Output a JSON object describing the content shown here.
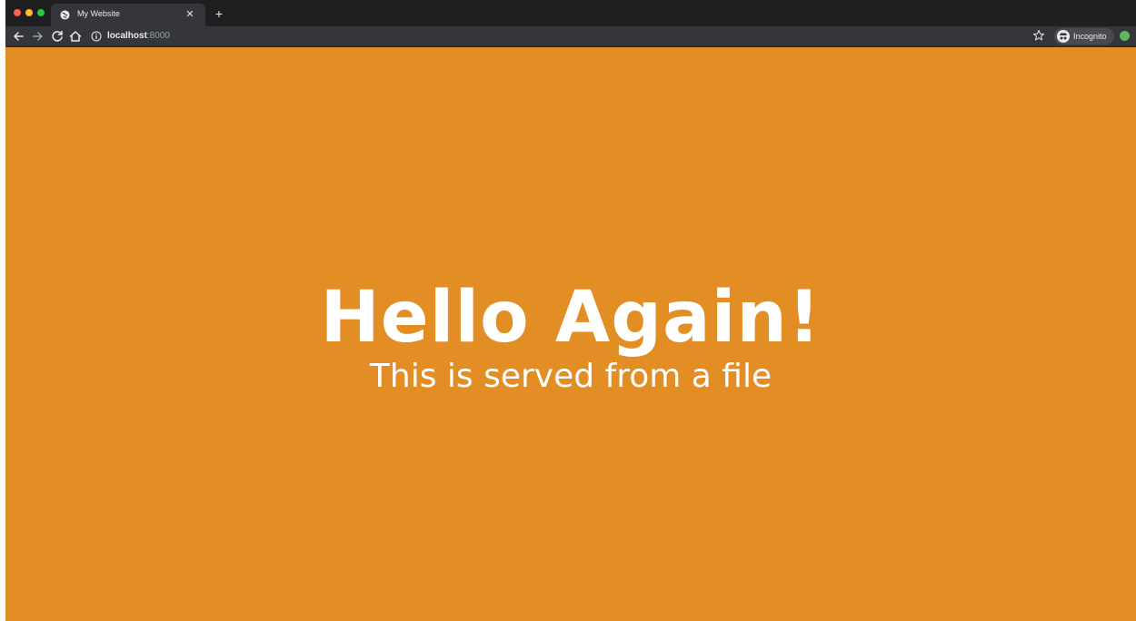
{
  "browser": {
    "tab": {
      "title": "My Website",
      "favicon": "globe-icon",
      "close_icon": "close-icon"
    },
    "new_tab_icon": "plus-icon",
    "toolbar": {
      "back_icon": "arrow-left-icon",
      "forward_icon": "arrow-right-icon",
      "reload_icon": "reload-icon",
      "home_icon": "home-icon",
      "info_icon": "info-icon",
      "url_host": "localhost",
      "url_port": ":8000",
      "bookmark_icon": "star-icon",
      "incognito_label": "Incognito",
      "incognito_icon": "incognito-icon",
      "extension_icon": "extension-icon"
    }
  },
  "page": {
    "background_color": "#e38d25",
    "heading": "Hello Again!",
    "subheading": "This is served from a file"
  }
}
